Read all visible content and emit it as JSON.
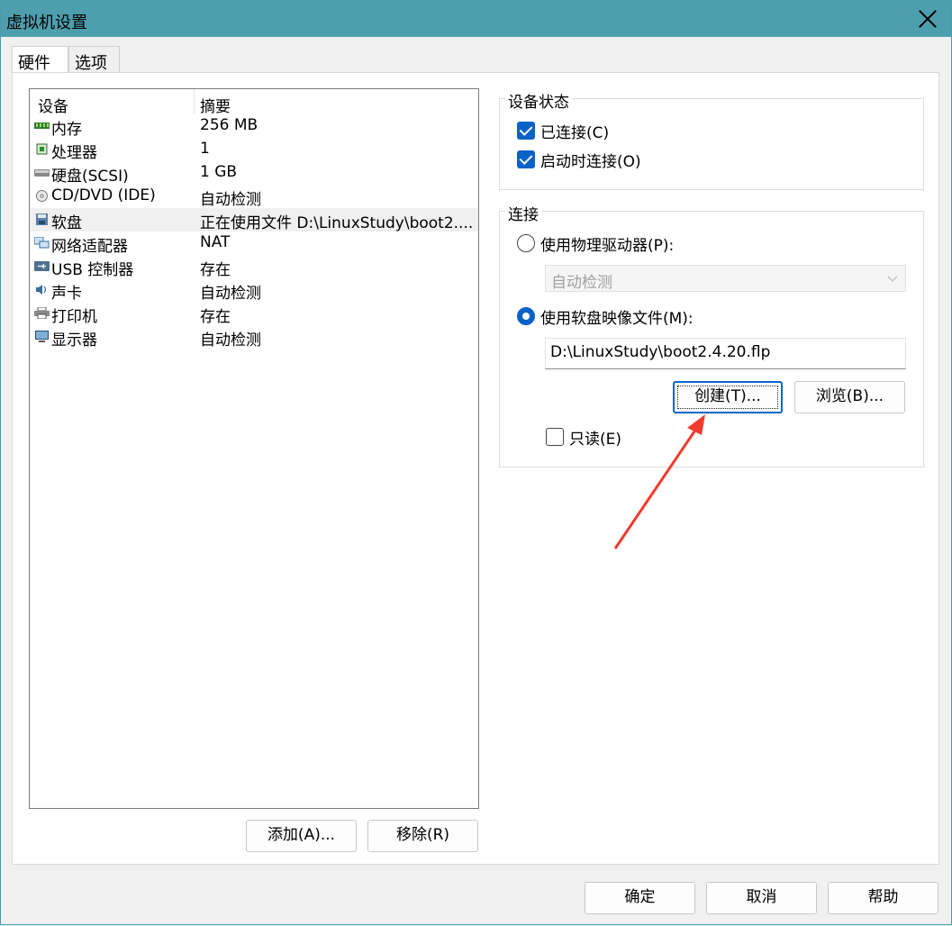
{
  "window": {
    "title": "虚拟机设置"
  },
  "tabs": [
    {
      "label": "硬件"
    },
    {
      "label": "选项"
    }
  ],
  "devices": {
    "columns": {
      "device": "设备",
      "summary": "摘要"
    },
    "items": [
      {
        "name": "内存",
        "summary": "256 MB",
        "icon": "memory-icon"
      },
      {
        "name": "处理器",
        "summary": "1",
        "icon": "processor-icon"
      },
      {
        "name": "硬盘(SCSI)",
        "summary": "1 GB",
        "icon": "hard-disk-icon"
      },
      {
        "name": "CD/DVD (IDE)",
        "summary": "自动检测",
        "icon": "cd-dvd-icon"
      },
      {
        "name": "软盘",
        "summary": "正在使用文件 D:\\LinuxStudy\\boot2....",
        "icon": "floppy-icon"
      },
      {
        "name": "网络适配器",
        "summary": "NAT",
        "icon": "network-adapter-icon"
      },
      {
        "name": "USB 控制器",
        "summary": "存在",
        "icon": "usb-icon"
      },
      {
        "name": "声卡",
        "summary": "自动检测",
        "icon": "sound-card-icon"
      },
      {
        "name": "打印机",
        "summary": "存在",
        "icon": "printer-icon"
      },
      {
        "name": "显示器",
        "summary": "自动检测",
        "icon": "display-icon"
      }
    ],
    "selected_index": 4
  },
  "buttons": {
    "add": "添加(A)...",
    "remove": "移除(R)",
    "create": "创建(T)...",
    "browse": "浏览(B)...",
    "ok": "确定",
    "cancel": "取消",
    "help": "帮助"
  },
  "device_status": {
    "title": "设备状态",
    "connected": {
      "label": "已连接(C)",
      "checked": true
    },
    "connect_at_power_on": {
      "label": "启动时连接(O)",
      "checked": true
    }
  },
  "connection": {
    "title": "连接",
    "physical": {
      "label": "使用物理驱动器(P):",
      "selected": false
    },
    "physical_select": "自动检测",
    "image": {
      "label": "使用软盘映像文件(M):",
      "selected": true
    },
    "image_path": "D:\\LinuxStudy\\boot2.4.20.flp",
    "readonly": {
      "label": "只读(E)",
      "checked": false
    }
  },
  "colors": {
    "titlebar": "#4e9fae",
    "accent": "#0b62c6",
    "annotation_arrow": "#f23b2f"
  }
}
